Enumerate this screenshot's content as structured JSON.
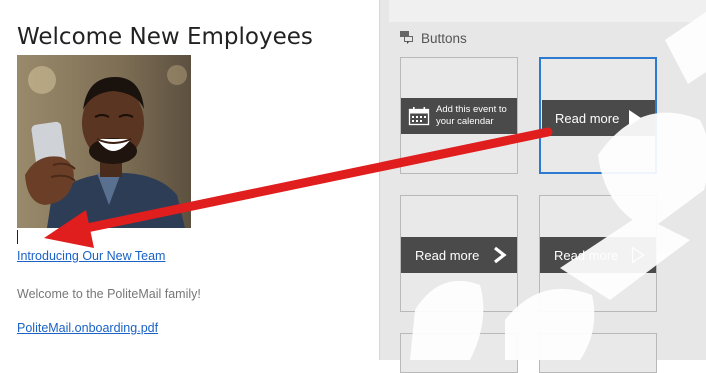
{
  "email": {
    "title": "Welcome New Employees",
    "hero_image": "smiling man holding phone",
    "link_team": "Introducing Our New Team",
    "body_text": "Welcome to the PoliteMail family!",
    "link_pdf": "PoliteMail.onboarding.pdf"
  },
  "buttons_panel": {
    "title": "Buttons",
    "icon": "buttons-icon",
    "tiles": [
      {
        "label": "Add this event to your calendar",
        "line1": "Add this event to",
        "line2": "your calendar",
        "icon": "calendar-icon"
      },
      {
        "label": "Read more",
        "icon": "play-triangle-icon",
        "selected": true
      },
      {
        "label": "Read more",
        "icon": "chevron-right-icon"
      },
      {
        "label": "Read more",
        "icon": "play-outline-icon"
      }
    ]
  },
  "colors": {
    "link": "#1a62c6",
    "selection": "#2d7bd1",
    "arrow": "#e01e1e",
    "button_bar": "#4a4a4a"
  }
}
